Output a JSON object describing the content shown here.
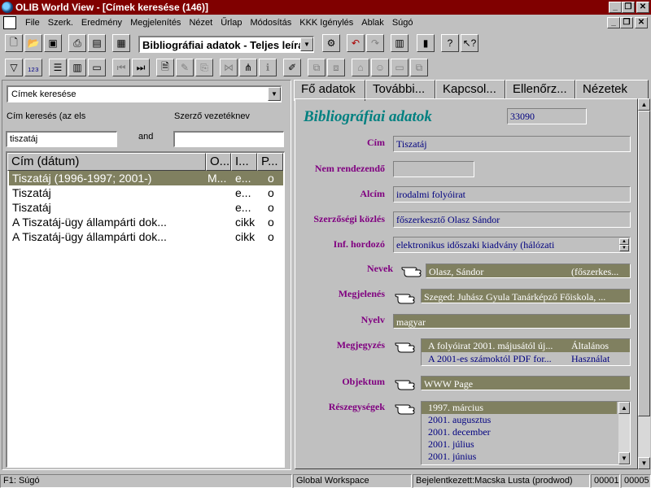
{
  "window": {
    "title": "OLIB World View - [Címek keresése (146)]"
  },
  "menu": [
    "File",
    "Szerk.",
    "Eredmény",
    "Megjelenítés",
    "Nézet",
    "Űrlap",
    "Módosítás",
    "KKK Igénylés",
    "Ablak",
    "Súgó"
  ],
  "toolbar": {
    "record_type": "Bibliográfiai adatok - Teljes leírás"
  },
  "left": {
    "search_type": "Címek keresése",
    "title_label": "Cím keresés (az els",
    "author_label": "Szerző vezetéknev",
    "title_value": "tiszatáj",
    "and_label": "and",
    "author_value": "",
    "columns": [
      "Cím (dátum)",
      "O...",
      "I...",
      "P..."
    ],
    "rows": [
      {
        "title": "Tiszatáj  (1996-1997; 2001-)",
        "o": "M...",
        "i": "e...",
        "p": "o"
      },
      {
        "title": "Tiszatáj",
        "o": "",
        "i": "e...",
        "p": "o"
      },
      {
        "title": "Tiszatáj",
        "o": "",
        "i": "e...",
        "p": "o"
      },
      {
        "title": "A Tiszatáj-ügy állampárti dok...",
        "o": "",
        "i": "cikk",
        "p": "o"
      },
      {
        "title": "A Tiszatáj-ügy állampárti dok...",
        "o": "",
        "i": "cikk",
        "p": "o"
      }
    ]
  },
  "tabs": [
    "Fő adatok",
    "További...",
    "Kapcsol...",
    "Ellenőrz...",
    "Nézetek"
  ],
  "record": {
    "heading": "Bibliográfiai adatok",
    "id": "33090",
    "labels": {
      "cim": "Cím",
      "nem_rendezendo": "Nem rendezendő",
      "alcim": "Alcím",
      "szerzosegi": "Szerzőségi közlés",
      "inf_hordozo": "Inf. hordozó",
      "nevek": "Nevek",
      "megjelenes": "Megjelenés",
      "nyelv": "Nyelv",
      "megjegyzes": "Megjegyzés",
      "objektum": "Objektum",
      "reszegysegek": "Részegységek"
    },
    "cim": "Tiszatáj",
    "nem_rendezendo": "",
    "alcim": "irodalmi folyóirat",
    "szerzosegi": "főszerkesztő Olasz Sándor",
    "inf_hordozo": "elektronikus időszaki kiadvány (hálózati",
    "nevek": {
      "name": "Olasz, Sándor",
      "role": "(főszerkes..."
    },
    "megjelenes": "Szeged: Juhász Gyula Tanárképző Főiskola, ...",
    "nyelv": "magyar",
    "megjegyzes": [
      {
        "text": "A folyóirat 2001. májusától új...",
        "type": "Általános"
      },
      {
        "text": "A 2001-es számoktól PDF for...",
        "type": "Használat"
      }
    ],
    "objektum": "WWW Page",
    "reszegysegek": [
      "1997. március",
      "2001. augusztus",
      "2001. december",
      "2001. július",
      "2001. június"
    ]
  },
  "status": {
    "help": "F1: Súgó",
    "workspace": "Global Workspace",
    "user": "Bejelentkezett:Macska Lusta (prodwod)",
    "c1": "00001",
    "c2": "00005"
  }
}
